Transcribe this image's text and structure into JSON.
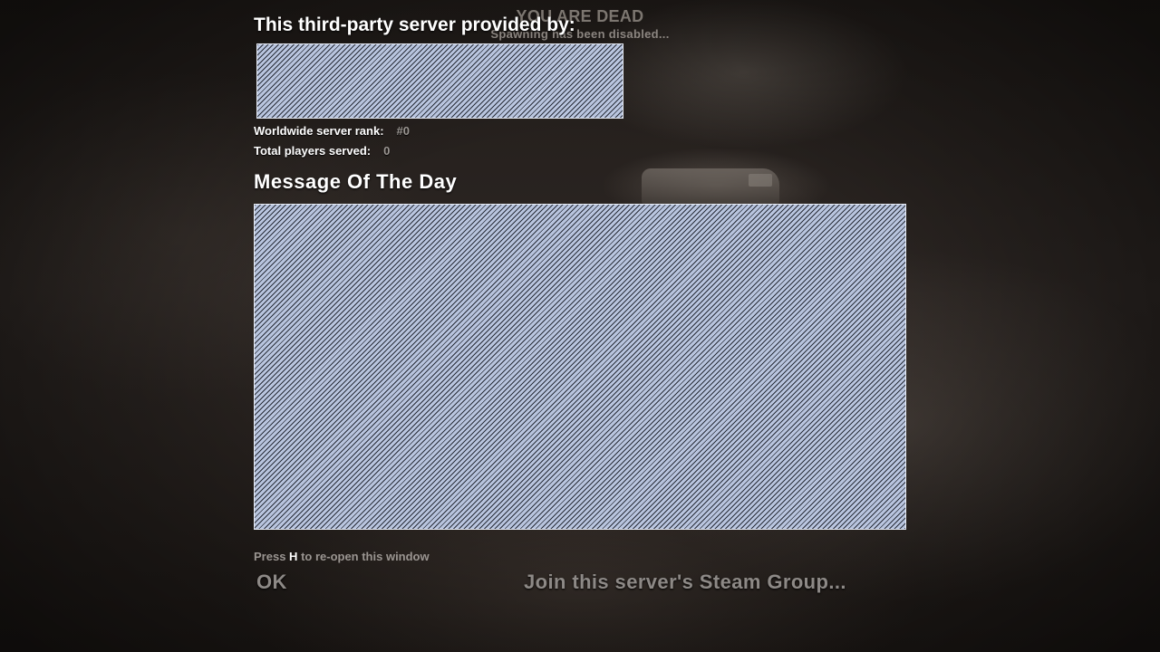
{
  "status": {
    "title": "YOU ARE DEAD",
    "subtitle": "Spawning has been disabled..."
  },
  "provider": {
    "title": "This third-party server provided by:",
    "rank_label": "Worldwide server rank:",
    "rank_value": "#0",
    "players_label": "Total players served:",
    "players_value": "0"
  },
  "motd": {
    "title": "Message Of The Day"
  },
  "footer": {
    "hint_prefix": "Press",
    "hint_key": "H",
    "hint_suffix": "to re-open this window",
    "ok_label": "OK",
    "steam_group_label": "Join this server's Steam Group..."
  },
  "colors": {
    "placeholder_fill": "#b9c5df",
    "button_text": "#8d8986",
    "heading_text": "#ffffff"
  }
}
